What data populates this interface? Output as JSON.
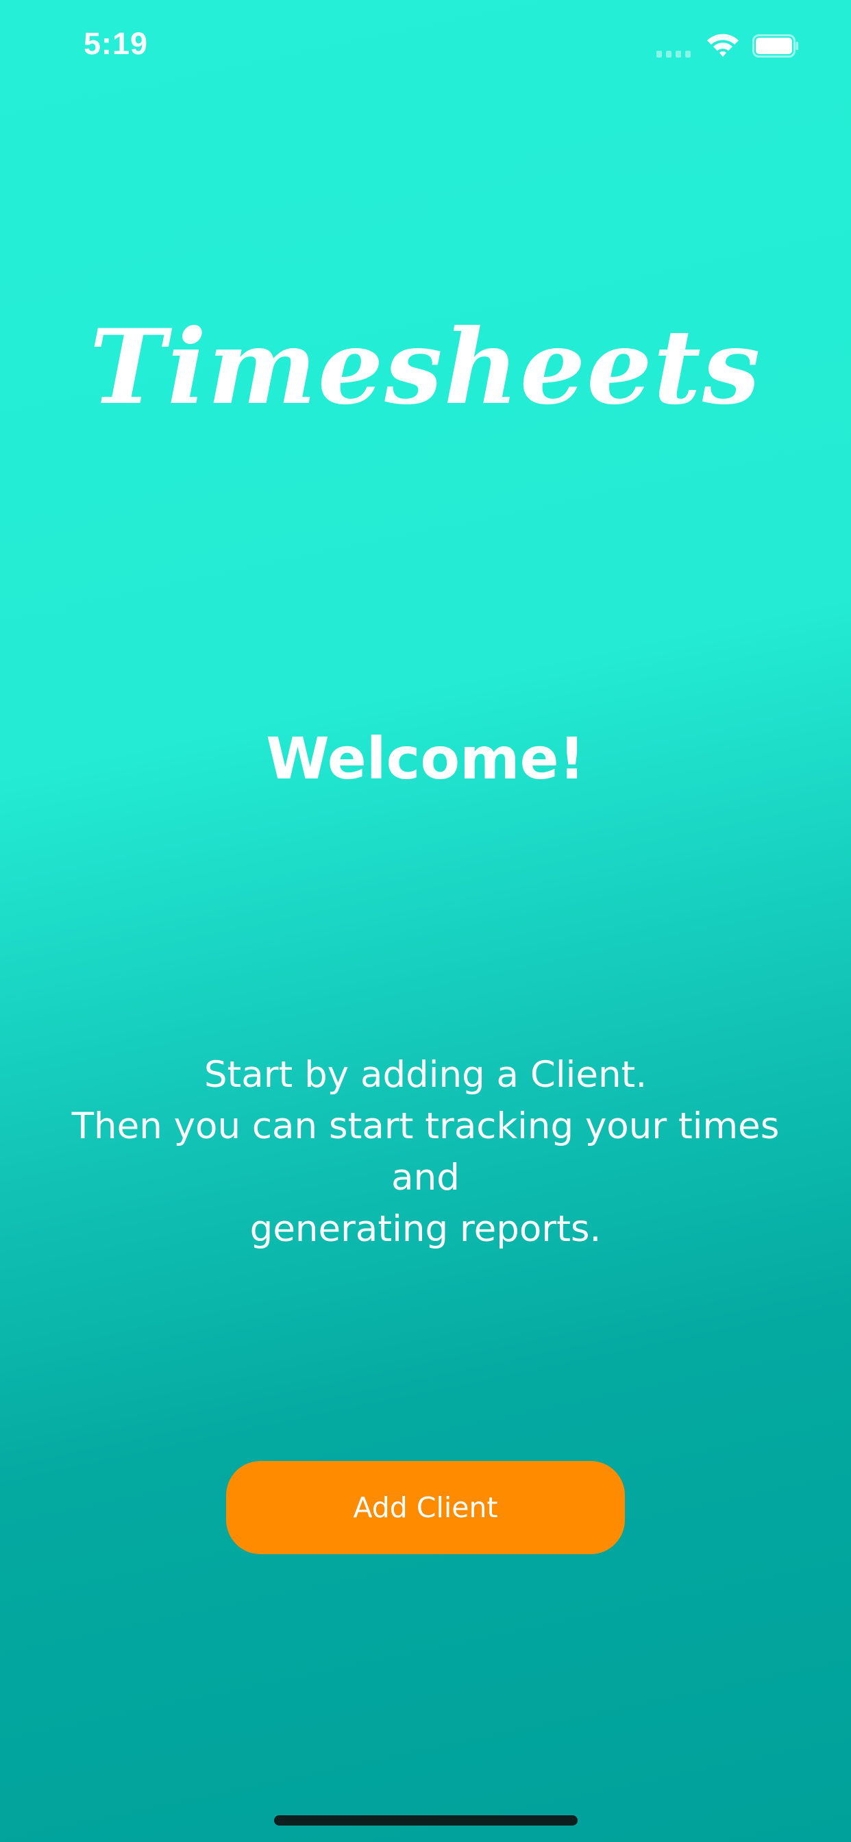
{
  "status_bar": {
    "time": "5:19",
    "signal_icon": "cellular-signal-icon",
    "wifi_icon": "wifi-icon",
    "battery_icon": "battery-icon"
  },
  "app": {
    "title": "Timesheets",
    "welcome": "Welcome!",
    "intro_lines": [
      "Start by adding a Client.",
      "Then you can start tracking your times and",
      "generating reports."
    ],
    "add_client_label": "Add Client"
  },
  "colors": {
    "background_top": "#25efd6",
    "background_bottom": "#00a19a",
    "accent_button": "#ff8c00",
    "text": "#ffffff"
  }
}
